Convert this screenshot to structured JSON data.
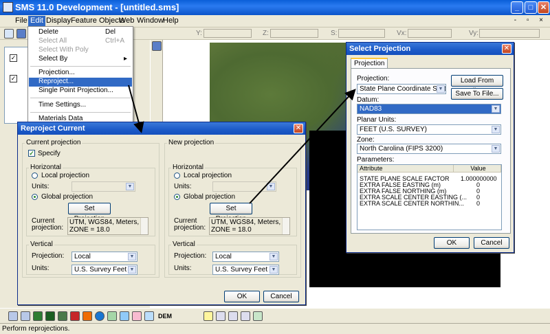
{
  "window": {
    "title": "SMS 11.0 Development - [untitled.sms]"
  },
  "menubar": {
    "items": [
      "File",
      "Edit",
      "Display",
      "Feature Objects",
      "Web",
      "Window",
      "Help"
    ]
  },
  "toolbar": {
    "coord_labels": [
      "Y:",
      "Z:",
      "S:",
      "Vx:",
      "Vy:"
    ]
  },
  "edit_menu": {
    "items": [
      {
        "label": "Delete",
        "shortcut": "Del"
      },
      {
        "label": "Select All",
        "shortcut": "Ctrl+A"
      },
      {
        "label": "Select With Poly",
        "shortcut": ""
      },
      {
        "label": "Select By",
        "shortcut": "▸"
      },
      {
        "label": "Projection...",
        "shortcut": ""
      },
      {
        "label": "Reproject...",
        "shortcut": ""
      },
      {
        "label": "Single Point Projection...",
        "shortcut": ""
      },
      {
        "label": "Time Settings...",
        "shortcut": ""
      },
      {
        "label": "Materials Data",
        "shortcut": ""
      }
    ]
  },
  "reproject_dialog": {
    "title": "Reproject Current",
    "current": {
      "group": "Current projection",
      "specify_label": "Specify",
      "horizontal": "Horizontal",
      "local_label": "Local projection",
      "units_label": "Units:",
      "global_label": "Global projection",
      "set_button": "Set Projection",
      "current_label": "Current\nprojection:",
      "current_value": "UTM, WGS84, Meters,\nZONE = 18.0",
      "vertical": "Vertical",
      "projection_label": "Projection:",
      "projection_value": "Local",
      "vunits_label": "Units:",
      "vunits_value": "U.S. Survey Feet"
    },
    "new": {
      "group": "New projection",
      "horizontal": "Horizontal",
      "local_label": "Local projection",
      "units_label": "Units:",
      "global_label": "Global projection",
      "set_button": "Set Projection",
      "current_label": "Current\nprojection:",
      "current_value": "UTM, WGS84, Meters,\nZONE = 18.0",
      "vertical": "Vertical",
      "projection_label": "Projection:",
      "projection_value": "Local",
      "vunits_label": "Units:",
      "vunits_value": "U.S. Survey Feet"
    },
    "ok": "OK",
    "cancel": "Cancel"
  },
  "select_projection_dialog": {
    "title": "Select Projection",
    "tab": "Projection",
    "projection_label": "Projection:",
    "projection_value": "State Plane Coordinate System",
    "load_button": "Load From File...",
    "save_button": "Save To File...",
    "datum_label": "Datum:",
    "datum_value": "NAD83",
    "planar_label": "Planar Units:",
    "planar_value": "FEET (U.S. SURVEY)",
    "zone_label": "Zone:",
    "zone_value": "North Carolina (FIPS 3200)",
    "params_label": "Parameters:",
    "params_headers": [
      "Attribute",
      "Value"
    ],
    "params": [
      {
        "attribute": "STATE PLANE SCALE FACTOR",
        "value": "1.000000000"
      },
      {
        "attribute": "EXTRA FALSE EASTING (m)",
        "value": "0"
      },
      {
        "attribute": "EXTRA FALSE NORTHING (m)",
        "value": "0"
      },
      {
        "attribute": "EXTRA SCALE CENTER EASTING (...",
        "value": "0"
      },
      {
        "attribute": "EXTRA SCALE CENTER NORTHIN...",
        "value": "0"
      }
    ],
    "ok": "OK",
    "cancel": "Cancel"
  },
  "toolbar_bottom": {
    "label": "DEM"
  },
  "status": {
    "text": "Perform reprojections."
  },
  "colors": {
    "title_blue": "#1c5ac8",
    "highlight": "#316ac5",
    "face": "#ece9d8"
  }
}
